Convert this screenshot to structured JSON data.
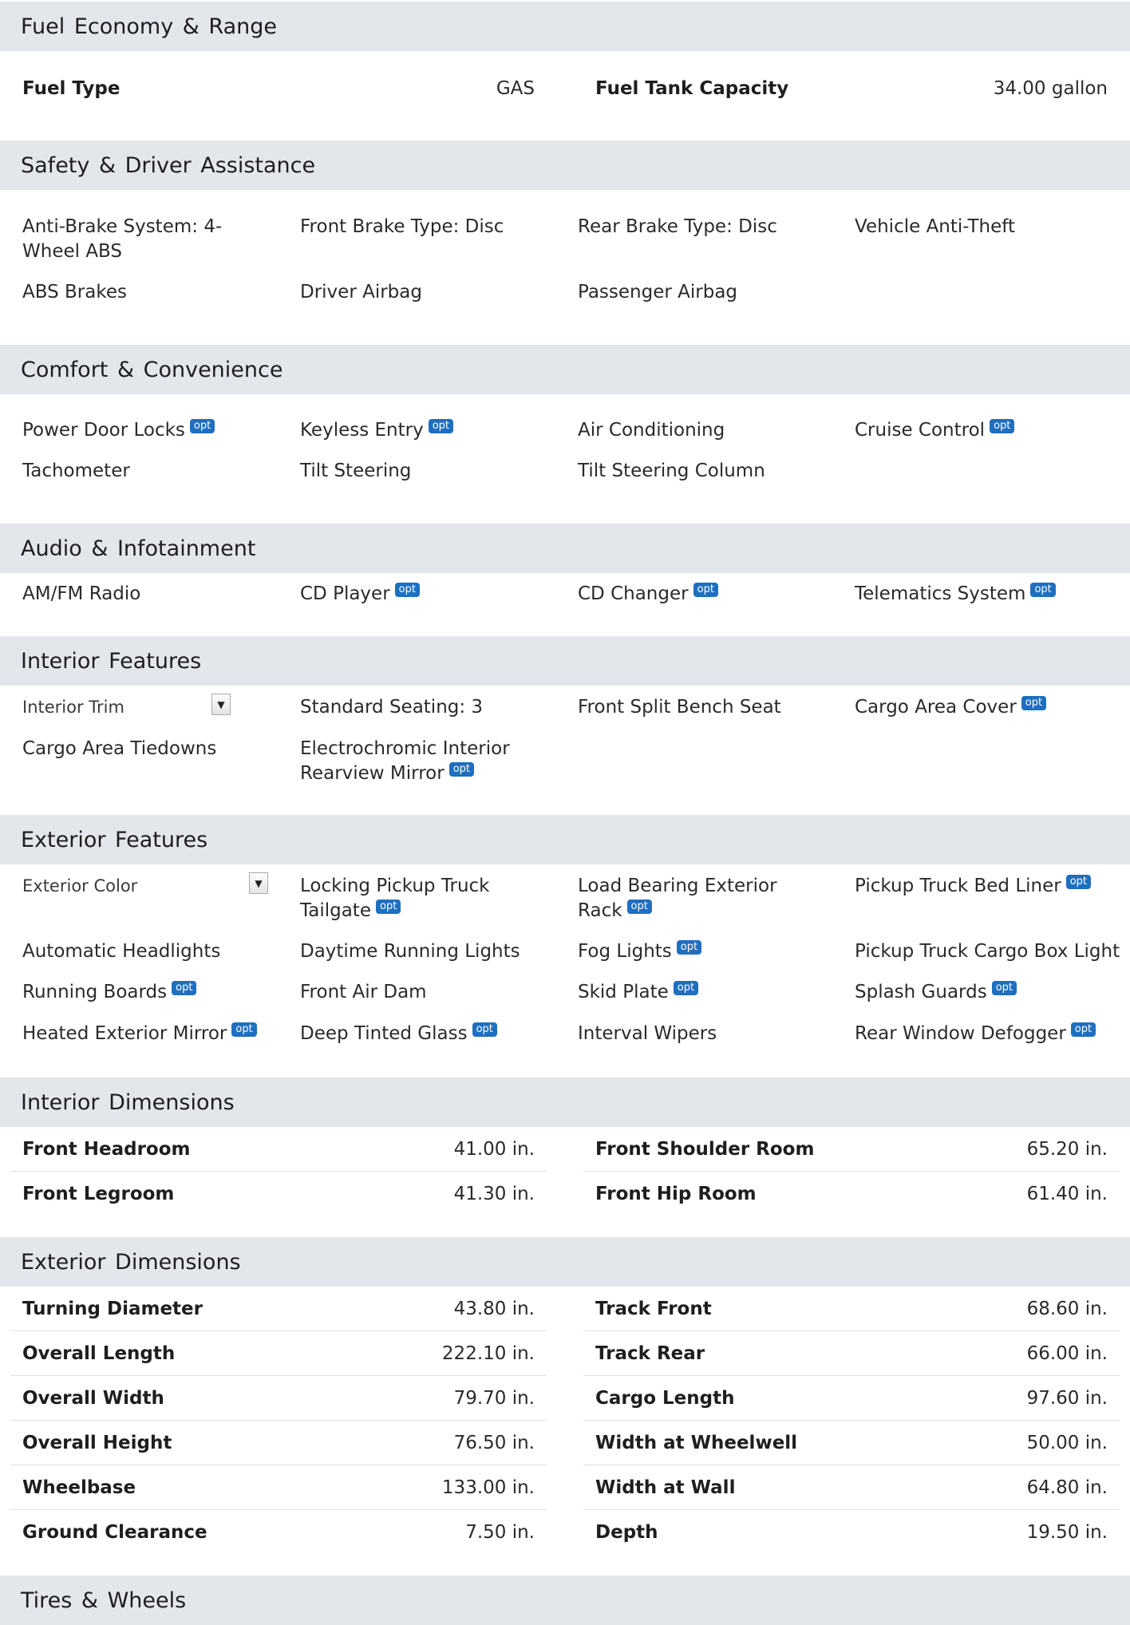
{
  "sections": {
    "fuel": {
      "title": "Fuel Economy & Range"
    },
    "safety": {
      "title": "Safety & Driver Assistance"
    },
    "comfort": {
      "title": "Comfort & Convenience"
    },
    "audio": {
      "title": "Audio & Infotainment"
    },
    "interior": {
      "title": "Interior Features"
    },
    "exterior": {
      "title": "Exterior Features"
    },
    "interior_dims": {
      "title": "Interior Dimensions"
    },
    "exterior_dims": {
      "title": "Exterior Dimensions"
    },
    "tires": {
      "title": "Tires & Wheels"
    }
  },
  "badge": {
    "opt": "opt"
  },
  "fuel": {
    "fuel_type_label": "Fuel Type",
    "fuel_type_value": "GAS",
    "tank_label": "Fuel Tank Capacity",
    "tank_value": "34.00 gallon"
  },
  "safety": [
    "Anti-Brake System: 4-Wheel ABS",
    "Front Brake Type: Disc",
    "Rear Brake Type: Disc",
    "Vehicle Anti-Theft",
    "ABS Brakes",
    "Driver Airbag",
    "Passenger Airbag"
  ],
  "comfort": [
    "Power Door Locks",
    "Keyless Entry",
    "Air Conditioning",
    "Cruise Control",
    "Tachometer",
    "Tilt Steering",
    "Tilt Steering Column"
  ],
  "audio": [
    "AM/FM Radio",
    "CD Player",
    "CD Changer",
    "Telematics System"
  ],
  "interior": {
    "trim_select": "Interior Trim",
    "items": [
      "Standard Seating: 3",
      "Front Split Bench Seat",
      "Cargo Area Cover",
      "Cargo Area Tiedowns",
      "Electrochromic Interior Rearview Mirror"
    ]
  },
  "exterior": {
    "color_select": "Exterior Color",
    "items": [
      "Locking Pickup Truck Tailgate",
      "Load Bearing Exterior Rack",
      "Pickup Truck Bed Liner",
      "Automatic Headlights",
      "Daytime Running Lights",
      "Fog Lights",
      "Pickup Truck Cargo Box Light",
      "Running Boards",
      "Front Air Dam",
      "Skid Plate",
      "Splash Guards",
      "Heated Exterior Mirror",
      "Deep Tinted Glass",
      "Interval Wipers",
      "Rear Window Defogger"
    ]
  },
  "interior_dims": [
    {
      "label": "Front Headroom",
      "value": "41.00 in."
    },
    {
      "label": "Front Shoulder Room",
      "value": "65.20 in."
    },
    {
      "label": "Front Legroom",
      "value": "41.30 in."
    },
    {
      "label": "Front Hip Room",
      "value": "61.40 in."
    }
  ],
  "exterior_dims": [
    {
      "label": "Turning Diameter",
      "value": "43.80 in."
    },
    {
      "label": "Track Front",
      "value": "68.60 in."
    },
    {
      "label": "Overall Length",
      "value": "222.10 in."
    },
    {
      "label": "Track Rear",
      "value": "66.00 in."
    },
    {
      "label": "Overall Width",
      "value": "79.70 in."
    },
    {
      "label": "Cargo Length",
      "value": "97.60 in."
    },
    {
      "label": "Overall Height",
      "value": "76.50 in."
    },
    {
      "label": "Width at Wheelwell",
      "value": "50.00 in."
    },
    {
      "label": "Wheelbase",
      "value": "133.00 in."
    },
    {
      "label": "Width at Wall",
      "value": "64.80 in."
    },
    {
      "label": "Ground Clearance",
      "value": "7.50 in."
    },
    {
      "label": "Depth",
      "value": "19.50 in."
    }
  ]
}
